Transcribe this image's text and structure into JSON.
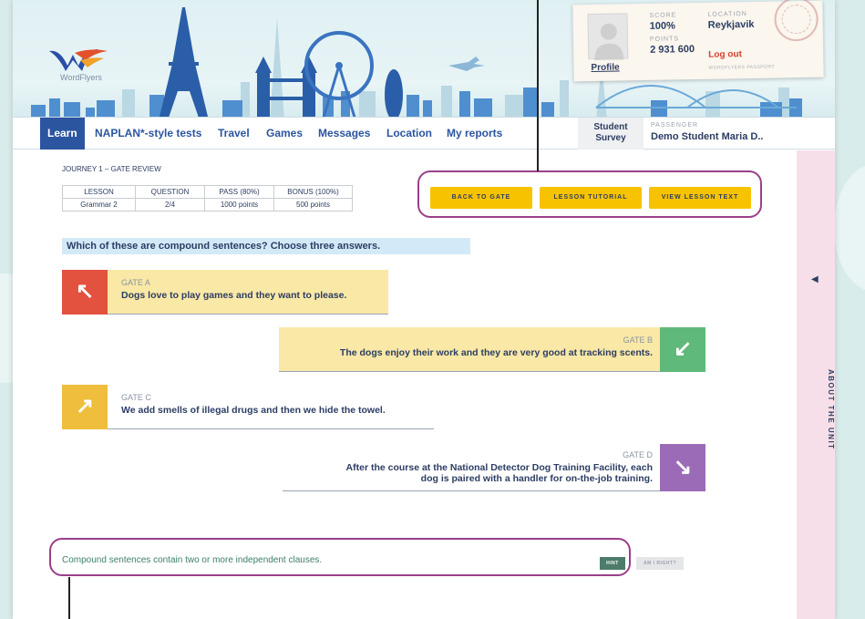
{
  "logo": {
    "text": "WordFlyers"
  },
  "profile_card": {
    "profile_link": "Profile",
    "score_label": "SCORE",
    "score_value": "100%",
    "points_label": "POINTS",
    "points_value": "2 931 600",
    "location_label": "LOCATION",
    "location_value": "Reykjavik",
    "logout_label": "Log out",
    "passport_text": "WORDFLYERS PASSPORT"
  },
  "nav": {
    "tabs": [
      {
        "label": "Learn"
      },
      {
        "label": "NAPLAN*-style tests"
      },
      {
        "label": "Travel"
      },
      {
        "label": "Games"
      },
      {
        "label": "Messages"
      },
      {
        "label": "Location"
      },
      {
        "label": "My reports"
      }
    ],
    "survey_line1": "Student",
    "survey_line2": "Survey",
    "passenger_label": "PASSENGER",
    "passenger_name": "Demo Student Maria D.."
  },
  "review": {
    "journey_title": "JOURNEY 1 – GATE REVIEW",
    "table_headers": [
      "LESSON",
      "QUESTION",
      "PASS (80%)",
      "BONUS (100%)"
    ],
    "table_values": [
      "Grammar 2",
      "2/4",
      "1000 points",
      "500 points"
    ]
  },
  "actions": {
    "back_to_gate": "BACK TO GATE",
    "lesson_tutorial": "LESSON TUTORIAL",
    "view_lesson_text": "VIEW LESSON TEXT"
  },
  "question": "Which of these are compound sentences? Choose three answers.",
  "gates": [
    {
      "title": "GATE A",
      "text": "Dogs love to play games and they want to please.",
      "selected": true,
      "icon": "arrow-up-left-icon",
      "color": "#e3513f"
    },
    {
      "title": "GATE B",
      "text": "The dogs enjoy their work and they are very good at tracking scents.",
      "selected": true,
      "icon": "arrow-down-left-icon",
      "color": "#5fb97a"
    },
    {
      "title": "GATE C",
      "text": "We add smells of illegal drugs and then we hide the towel.",
      "selected": false,
      "icon": "arrow-up-right-icon",
      "color": "#eebe3c"
    },
    {
      "title": "GATE D",
      "text_line1": "After the course at the National Detector Dog Training Facility, each",
      "text_line2": "dog is paired with a handler for on-the-job training.",
      "selected": false,
      "icon": "arrow-down-right-icon",
      "color": "#9b6bb7"
    }
  ],
  "icon_glyphs": {
    "up_left": "↖",
    "down_left": "↙",
    "up_right": "↗",
    "down_right": "↘"
  },
  "hint": {
    "text": "Compound sentences contain two or more independent clauses.",
    "hint_button": "HINT",
    "am_i_right_button": "AM I RIGHT?"
  },
  "side_panel": {
    "label": "ABOUT THE UNIT",
    "arrow": "◀"
  },
  "colors": {
    "brand_blue": "#2c55a0",
    "gold": "#f7c300",
    "highlight_outline": "#9b3f8a",
    "selected_gate_bg": "#f9e8a6",
    "side_panel": "#f6dfe8"
  }
}
